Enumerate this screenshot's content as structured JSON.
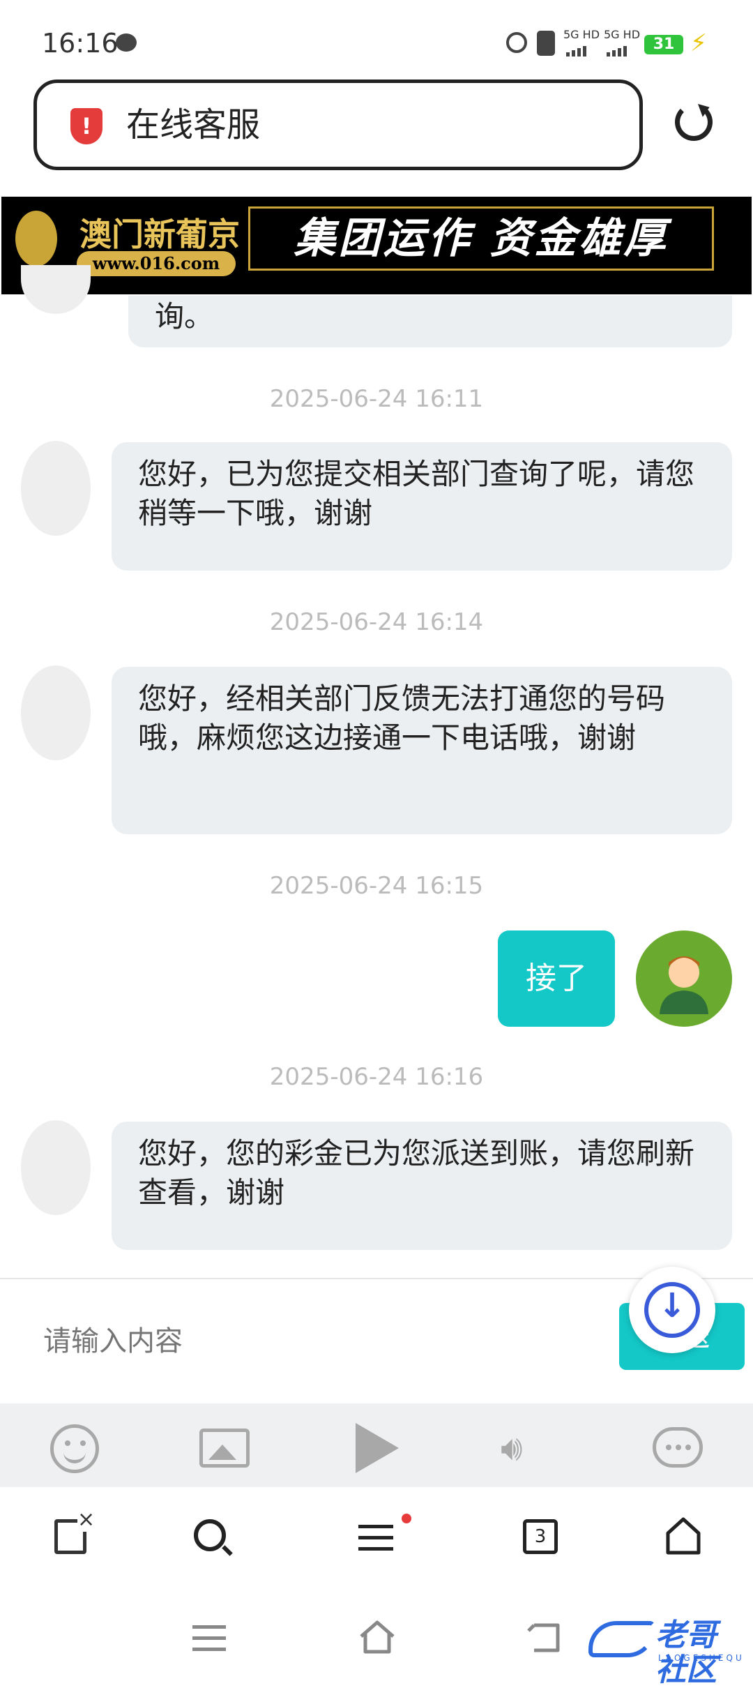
{
  "status_bar": {
    "time": "16:16",
    "net1": "5G HD",
    "net2": "5G HD",
    "battery": "31"
  },
  "address_bar": {
    "title": "在线客服"
  },
  "banner": {
    "brand": "澳门新葡京",
    "url": "www.016.com",
    "slogan": "集团运作 资金雄厚"
  },
  "chat": {
    "partial_message": "询。",
    "messages": [
      {
        "timestamp": "2025-06-24 16:11",
        "from": "agent",
        "text": "您好，已为您提交相关部门查询了呢，请您稍等一下哦，谢谢"
      },
      {
        "timestamp": "2025-06-24 16:14",
        "from": "agent",
        "text": "您好，经相关部门反馈无法打通您的号码哦，麻烦您这边接通一下电话哦，谢谢"
      },
      {
        "timestamp": "2025-06-24 16:15",
        "from": "user",
        "text": "接了"
      },
      {
        "timestamp": "2025-06-24 16:16",
        "from": "agent",
        "text": "您好，您的彩金已为您派送到账，请您刷新查看，谢谢"
      }
    ]
  },
  "input": {
    "placeholder": "请输入内容",
    "send_label": "发送"
  },
  "browser_nav": {
    "tab_count": "3"
  },
  "watermark": {
    "text": "老哥社区",
    "sub": "LAOGESHEQU"
  },
  "colors": {
    "accent": "#14c8c8",
    "bubble": "#eceff1",
    "timestamp": "#bbbbbb",
    "banner_gold": "#c9a437"
  },
  "icons": [
    "message-icon",
    "alarm-icon",
    "vibrate-icon",
    "shield-alert-icon",
    "reload-icon",
    "emoji-icon",
    "image-icon",
    "play-icon",
    "volume-icon",
    "chat-bubble-icon",
    "close-tab-icon",
    "search-icon",
    "menu-icon",
    "tabs-icon",
    "home-icon",
    "back-icon",
    "download-icon"
  ]
}
